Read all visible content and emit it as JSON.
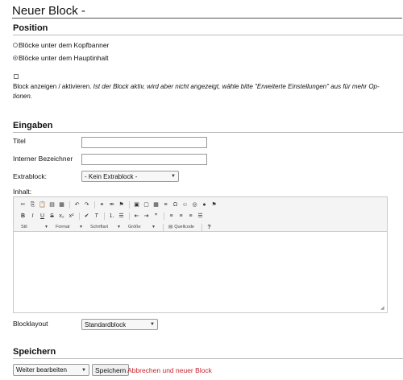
{
  "page": {
    "title": "Neuer Block -"
  },
  "position": {
    "heading": "Position",
    "options": [
      {
        "label": "Blöcke unter dem Kopfbanner",
        "selected": false
      },
      {
        "label": "Blöcke unter dem Hauptinhalt",
        "selected": true
      }
    ]
  },
  "activation": {
    "checked": false,
    "label": "Block anzeigen / aktivieren.",
    "hint_line1": "Ist der Block aktiv, wird aber nicht angezeigt, wähle bitte \"Erweiterte Einstellungen\" aus für mehr Op-",
    "hint_line2": "tionen."
  },
  "inputs": {
    "heading": "Eingaben",
    "title_label": "Titel",
    "title_value": "",
    "internal_label": "Interner Bezeichner",
    "internal_value": "",
    "extrablock_label": "Extrablock:",
    "extrablock_value": "- Kein Extrablock -",
    "content_label": "Inhalt:"
  },
  "editor": {
    "format_combos": [
      "Stil",
      "Format",
      "Schriftart",
      "Größe"
    ],
    "source_label": "Quellcode",
    "help_label": "?",
    "row1_icons": [
      "cut-icon",
      "copy-icon",
      "paste-icon",
      "paste-text-icon",
      "paste-word-icon",
      "undo-icon",
      "redo-icon",
      "link-icon",
      "unlink-icon",
      "anchor-icon",
      "image-icon",
      "flash-icon",
      "table-icon",
      "horizontal-rule-icon",
      "special-char-icon",
      "smiley-icon",
      "iframe-icon",
      "page-break-icon",
      "flag-icon"
    ],
    "row2_icons": [
      "bold-icon",
      "italic-icon",
      "underline-icon",
      "strike-icon",
      "subscript-icon",
      "superscript-icon",
      "remove-format-icon",
      "italic-clear-icon",
      "numbered-list-icon",
      "bullet-list-icon",
      "outdent-icon",
      "indent-icon",
      "blockquote-icon",
      "align-left-icon",
      "align-center-icon",
      "align-right-icon",
      "justify-icon"
    ]
  },
  "layout": {
    "label": "Blocklayout",
    "value": "Standardblock"
  },
  "save": {
    "heading": "Speichern",
    "mode_value": "Weiter bearbeiten",
    "save_label": "Speichern",
    "cancel_label": "Abbrechen und neuer Block"
  }
}
